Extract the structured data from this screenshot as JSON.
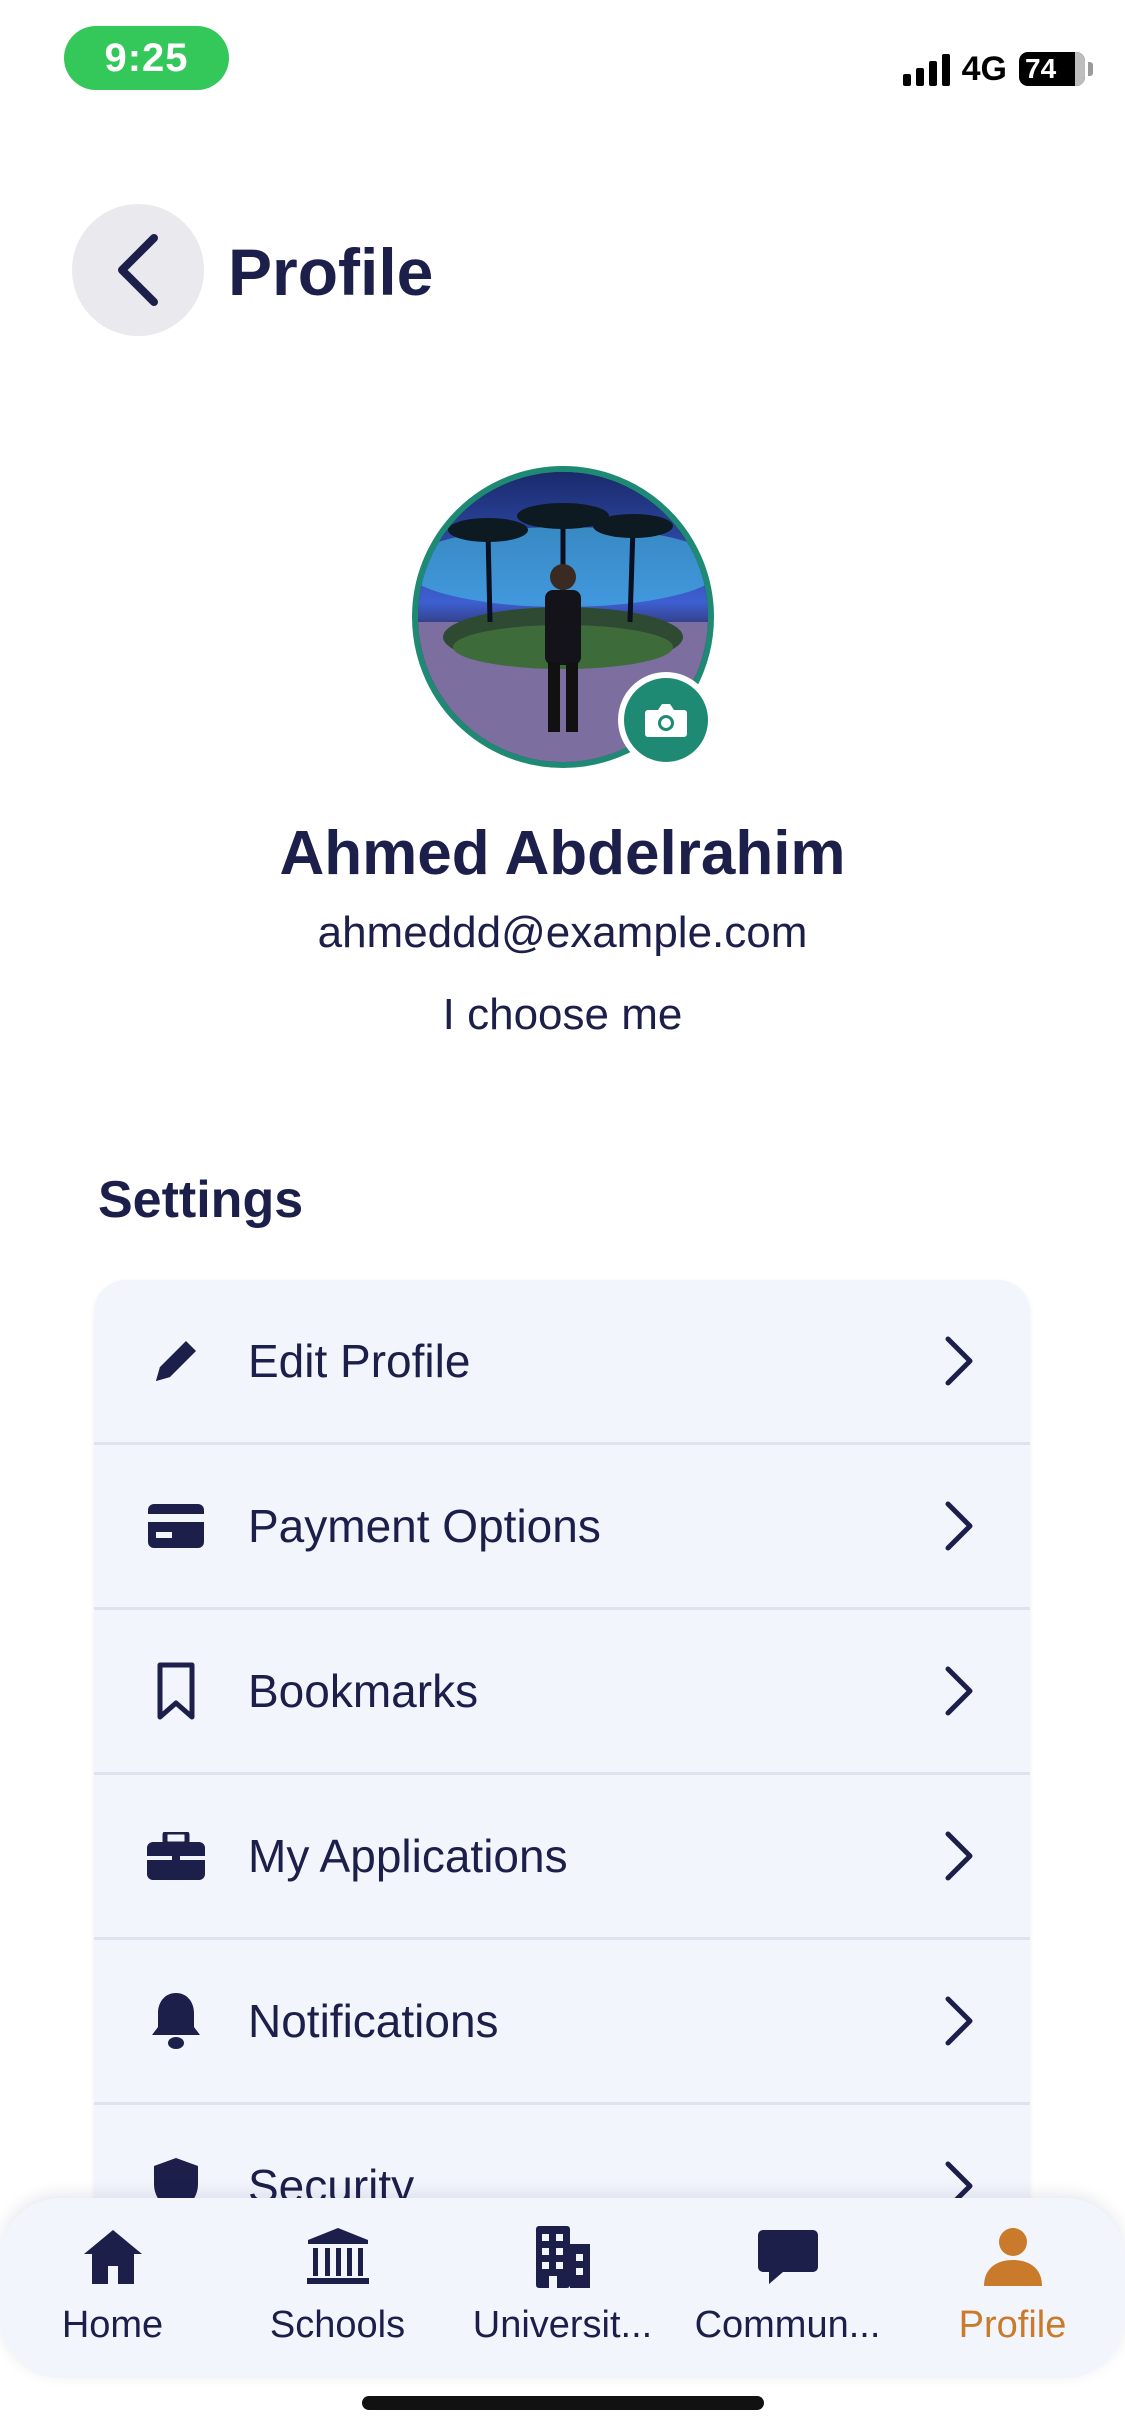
{
  "status_bar": {
    "time": "9:25",
    "network": "4G",
    "battery": "74"
  },
  "header": {
    "title": "Profile",
    "back_icon": "chevron-left-icon"
  },
  "profile": {
    "name": "Ahmed Abdelrahim",
    "email": "ahmeddd@example.com",
    "bio": "I choose me",
    "camera_icon": "camera-icon"
  },
  "settings": {
    "heading": "Settings",
    "items": [
      {
        "label": "Edit Profile",
        "icon": "pencil-icon"
      },
      {
        "label": "Payment Options",
        "icon": "credit-card-icon"
      },
      {
        "label": "Bookmarks",
        "icon": "bookmark-icon"
      },
      {
        "label": "My Applications",
        "icon": "briefcase-icon"
      },
      {
        "label": "Notifications",
        "icon": "bell-icon"
      },
      {
        "label": "Security",
        "icon": "shield-icon"
      }
    ]
  },
  "bottom_nav": {
    "items": [
      {
        "label": "Home",
        "icon": "home-icon",
        "active": false
      },
      {
        "label": "Schools",
        "icon": "school-icon",
        "active": false
      },
      {
        "label": "Universit...",
        "icon": "building-icon",
        "active": false
      },
      {
        "label": "Commun...",
        "icon": "chat-icon",
        "active": false
      },
      {
        "label": "Profile",
        "icon": "person-icon",
        "active": true
      }
    ]
  },
  "colors": {
    "primary_text": "#1c1f4a",
    "accent_teal": "#1e8a73",
    "active_tab": "#c97a2b",
    "card_background": "#f3f5fc",
    "status_pill": "#34c759"
  }
}
